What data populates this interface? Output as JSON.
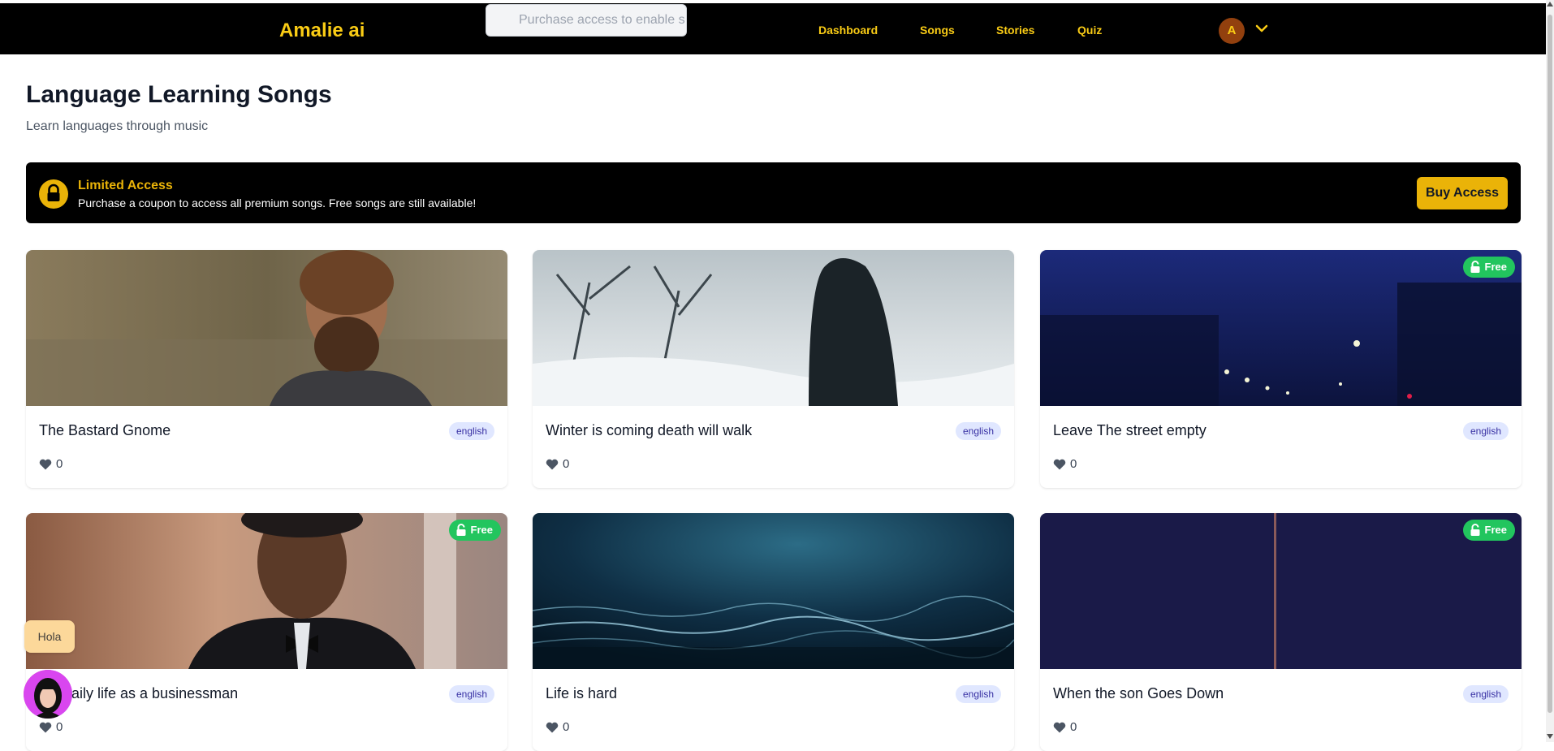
{
  "nav": {
    "brand": "Amalie ai",
    "search_placeholder": "Purchase access to enable s",
    "links": [
      "Dashboard",
      "Songs",
      "Stories",
      "Quiz"
    ],
    "avatar_initial": "A"
  },
  "page": {
    "title": "Language Learning Songs",
    "subtitle": "Learn languages through music"
  },
  "banner": {
    "title": "Limited Access",
    "text": "Purchase a coupon to access all premium songs. Free songs are still available!",
    "button": "Buy Access"
  },
  "songs": [
    {
      "title": "The Bastard Gnome",
      "language": "english",
      "likes": "0",
      "free": false
    },
    {
      "title": "Winter is coming death will walk",
      "language": "english",
      "likes": "0",
      "free": false
    },
    {
      "title": "Leave The street empty",
      "language": "english",
      "likes": "0",
      "free": true
    },
    {
      "title": "aily life as a businessman",
      "language": "english",
      "likes": "0",
      "free": true
    },
    {
      "title": "Life is hard",
      "language": "english",
      "likes": "0",
      "free": false
    },
    {
      "title": "When the son Goes Down",
      "language": "english",
      "likes": "0",
      "free": true
    }
  ],
  "free_label": "Free",
  "assistant": {
    "greeting": "Hola"
  },
  "colors": {
    "accent": "#facc15",
    "button": "#eab308",
    "free_badge": "#22c55e",
    "lang_badge_bg": "#e0e7ff"
  }
}
